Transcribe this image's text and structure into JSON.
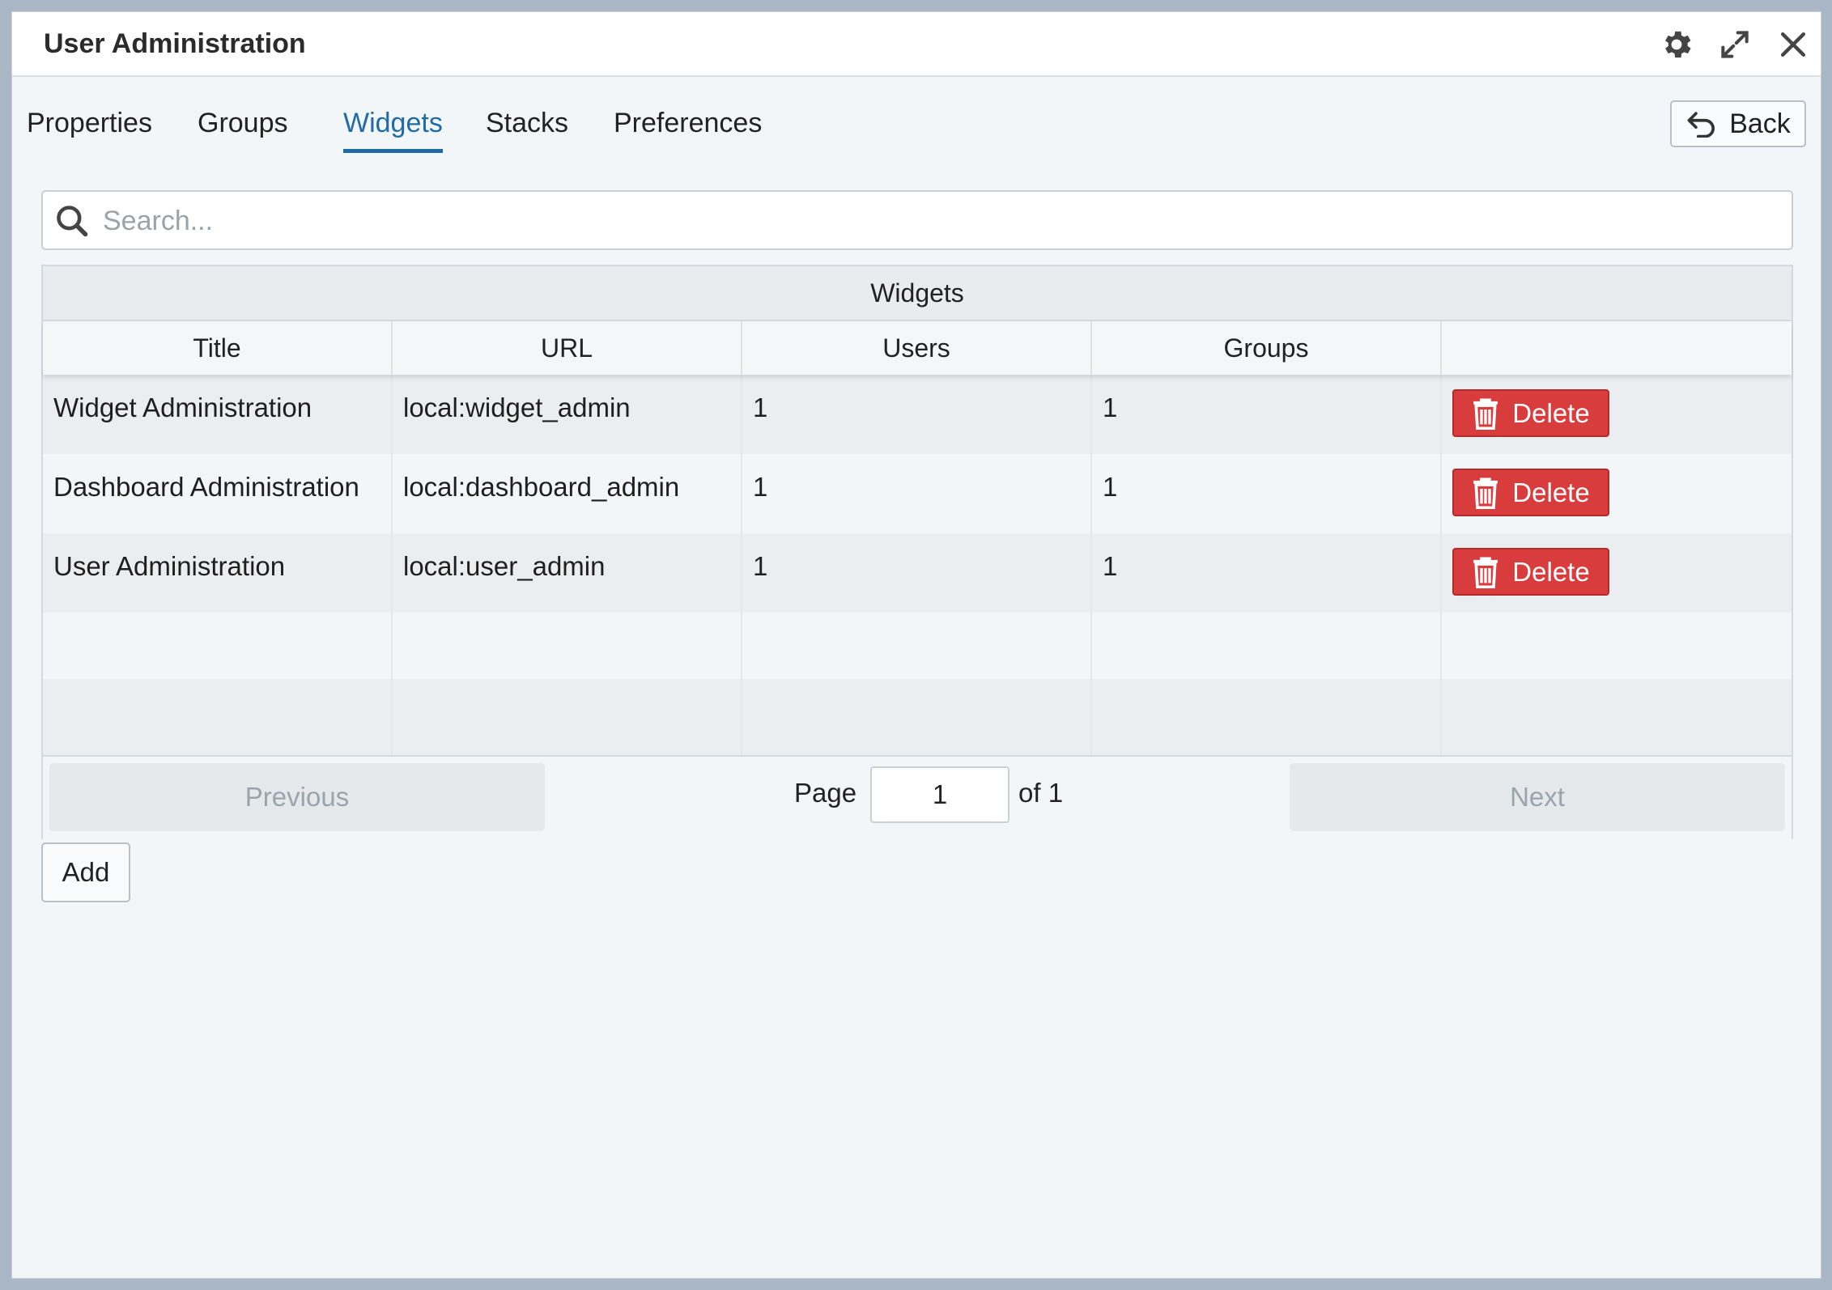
{
  "window": {
    "title": "User Administration"
  },
  "icons": {
    "settings": "gear-icon",
    "maximize": "expand-icon",
    "close": "close-icon",
    "back": "undo-arrow-icon",
    "search": "search-icon",
    "delete": "trash-icon"
  },
  "tabs": [
    {
      "label": "Properties",
      "active": false
    },
    {
      "label": "Groups",
      "active": false
    },
    {
      "label": "Widgets",
      "active": true
    },
    {
      "label": "Stacks",
      "active": false
    },
    {
      "label": "Preferences",
      "active": false
    }
  ],
  "back_button": {
    "label": "Back"
  },
  "search": {
    "placeholder": "Search...",
    "value": ""
  },
  "table": {
    "caption": "Widgets",
    "columns": [
      "Title",
      "URL",
      "Users",
      "Groups",
      ""
    ],
    "rows": [
      {
        "title": "Widget Administration",
        "url": "local:widget_admin",
        "users": "1",
        "groups": "1",
        "action": "Delete"
      },
      {
        "title": "Dashboard Administration",
        "url": "local:dashboard_admin",
        "users": "1",
        "groups": "1",
        "action": "Delete"
      },
      {
        "title": "User Administration",
        "url": "local:user_admin",
        "users": "1",
        "groups": "1",
        "action": "Delete"
      }
    ]
  },
  "pagination": {
    "previous": "Previous",
    "page_label": "Page",
    "page_value": "1",
    "of_label": "of 1",
    "next": "Next"
  },
  "add_button": {
    "label": "Add"
  },
  "colors": {
    "accent": "#1f6ca5",
    "danger": "#d93c3c",
    "background": "#f3f6f9"
  }
}
